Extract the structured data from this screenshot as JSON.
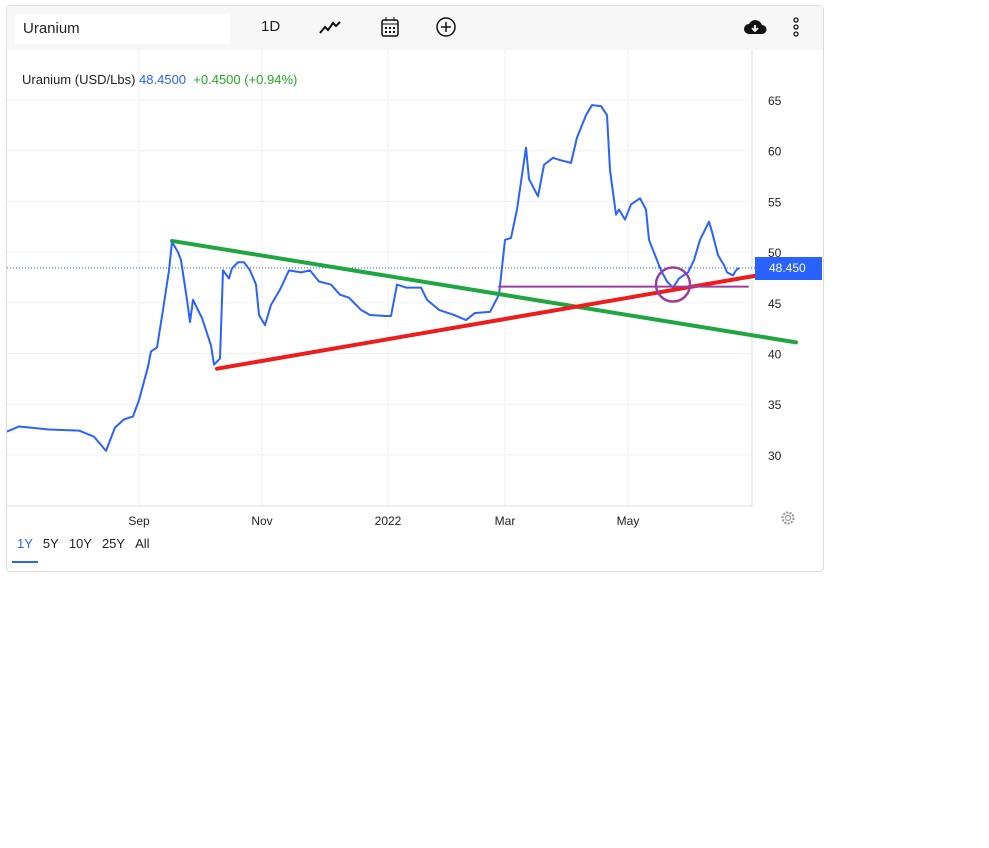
{
  "toolbar": {
    "symbol": "Uranium",
    "interval": "1D",
    "chart_type_icon": "line-chart-icon",
    "calendar_icon": "calendar-icon",
    "compare_icon": "plus-circle-icon",
    "download_icon": "cloud-download-icon",
    "more_icon": "more-vertical-icon"
  },
  "legend": {
    "name": "Uranium (USD/Lbs)",
    "price": "48.4500",
    "change": "+0.4500 (+0.94%)"
  },
  "price_tag": "48.450",
  "ranges": [
    "1Y",
    "5Y",
    "10Y",
    "25Y",
    "All"
  ],
  "active_range": "1Y",
  "colors": {
    "line": "#2962ff",
    "green": "#1fa640",
    "red": "#ee1c1c",
    "purple": "#9c3f9c"
  },
  "chart_data": {
    "type": "line",
    "title": "Uranium (USD/Lbs)",
    "xlabel": "",
    "ylabel": "",
    "x_unit": "trading day index",
    "ylim": [
      25,
      69
    ],
    "yticks": [
      30,
      35,
      40,
      45,
      50,
      55,
      60,
      65
    ],
    "xticks": [
      {
        "label": "Sep",
        "x": 44
      },
      {
        "label": "Nov",
        "x": 85
      },
      {
        "label": "2022",
        "x": 127
      },
      {
        "label": "Mar",
        "x": 166
      },
      {
        "label": "May",
        "x": 207
      }
    ],
    "series": [
      {
        "name": "Uranium",
        "points": [
          [
            0,
            32.3
          ],
          [
            4,
            32.8
          ],
          [
            14,
            32.5
          ],
          [
            24,
            32.4
          ],
          [
            29,
            31.8
          ],
          [
            33,
            30.4
          ],
          [
            36,
            32.7
          ],
          [
            39,
            33.5
          ],
          [
            42,
            33.8
          ],
          [
            44,
            35.4
          ],
          [
            47,
            38.7
          ],
          [
            48,
            40.2
          ],
          [
            50,
            40.6
          ],
          [
            52,
            44.3
          ],
          [
            54,
            48.2
          ],
          [
            55,
            51
          ],
          [
            57,
            50
          ],
          [
            58,
            49.2
          ],
          [
            60,
            45.3
          ],
          [
            61,
            43.1
          ],
          [
            62,
            45.3
          ],
          [
            65,
            43.5
          ],
          [
            68,
            40.8
          ],
          [
            69,
            38.9
          ],
          [
            71,
            39.5
          ],
          [
            72,
            48.2
          ],
          [
            74,
            47.4
          ],
          [
            75,
            48.4
          ],
          [
            77,
            49
          ],
          [
            79,
            49
          ],
          [
            81,
            48.2
          ],
          [
            83,
            46.8
          ],
          [
            84,
            43.8
          ],
          [
            86,
            42.8
          ],
          [
            88,
            44.8
          ],
          [
            91,
            46.3
          ],
          [
            94,
            48.2
          ],
          [
            98,
            48
          ],
          [
            101,
            48.2
          ],
          [
            104,
            47.1
          ],
          [
            108,
            46.8
          ],
          [
            111,
            45.8
          ],
          [
            114,
            45.5
          ],
          [
            118,
            44.3
          ],
          [
            121,
            43.8
          ],
          [
            126,
            43.7
          ],
          [
            128,
            43.7
          ],
          [
            130,
            46.8
          ],
          [
            133,
            46.5
          ],
          [
            138,
            46.5
          ],
          [
            140,
            45.3
          ],
          [
            144,
            44.3
          ],
          [
            149,
            43.8
          ],
          [
            153,
            43.3
          ],
          [
            156,
            44
          ],
          [
            161,
            44.1
          ],
          [
            164,
            45.8
          ],
          [
            166,
            51.2
          ],
          [
            168,
            51.4
          ],
          [
            170,
            54.2
          ],
          [
            173,
            60.3
          ],
          [
            174,
            57.2
          ],
          [
            177,
            55.5
          ],
          [
            179,
            58.6
          ],
          [
            182,
            59.3
          ],
          [
            184,
            59.1
          ],
          [
            188,
            58.8
          ],
          [
            190,
            61.3
          ],
          [
            193,
            63.5
          ],
          [
            195,
            64.5
          ],
          [
            198,
            64.4
          ],
          [
            200,
            63.5
          ],
          [
            201,
            58.1
          ],
          [
            203,
            53.7
          ],
          [
            204,
            54.2
          ],
          [
            206,
            53.2
          ],
          [
            208,
            54.7
          ],
          [
            211,
            55.3
          ],
          [
            213,
            54.2
          ],
          [
            214,
            51.2
          ],
          [
            216,
            49.7
          ],
          [
            218,
            48.2
          ],
          [
            220,
            47.1
          ],
          [
            222,
            46.5
          ],
          [
            224,
            47.4
          ],
          [
            227,
            48
          ],
          [
            229,
            49.2
          ],
          [
            231,
            51.2
          ],
          [
            234,
            53
          ],
          [
            235,
            52
          ],
          [
            237,
            49.7
          ],
          [
            239,
            48.7
          ],
          [
            240,
            48
          ],
          [
            242,
            47.7
          ],
          [
            243,
            48.2
          ],
          [
            244,
            48.45
          ]
        ]
      }
    ],
    "annotations": [
      {
        "type": "trendline",
        "color": "green",
        "from": [
          55,
          51.1
        ],
        "to": [
          263,
          41.1
        ]
      },
      {
        "type": "trendline",
        "color": "red",
        "from": [
          70,
          38.5
        ],
        "to": [
          254,
          47.9
        ]
      },
      {
        "type": "horizontal",
        "color": "purple",
        "from": [
          164,
          46.6
        ],
        "to": [
          247,
          46.6
        ]
      },
      {
        "type": "circle",
        "color": "purple",
        "center": [
          222,
          46.8
        ]
      }
    ]
  }
}
